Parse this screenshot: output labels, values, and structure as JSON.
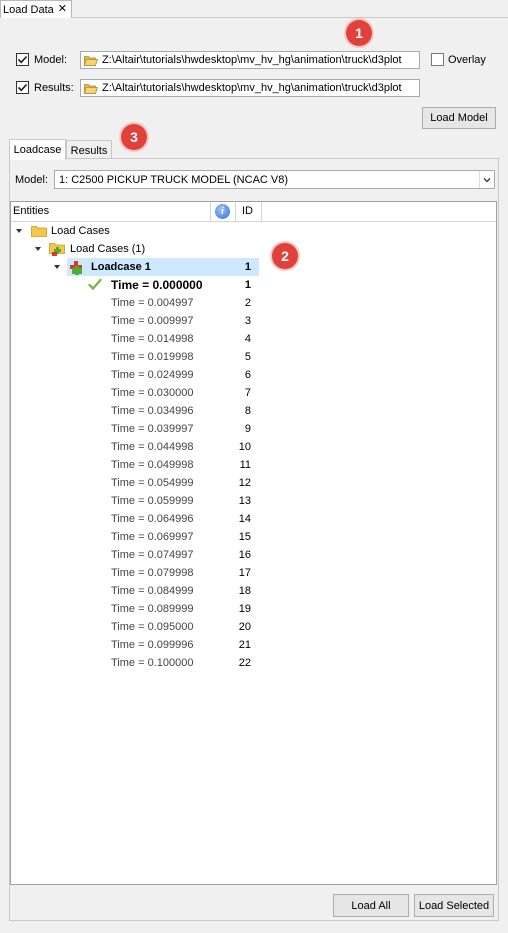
{
  "tab": {
    "title": "Load Data",
    "close": "✕"
  },
  "model_row": {
    "label": "Model:",
    "checked": true,
    "path": "Z:\\Altair\\tutorials\\hwdesktop\\mv_hv_hg\\animation\\truck\\d3plot"
  },
  "overlay": {
    "label": "Overlay",
    "checked": false
  },
  "results_row": {
    "label": "Results:",
    "checked": true,
    "path": "Z:\\Altair\\tutorials\\hwdesktop\\mv_hv_hg\\animation\\truck\\d3plot"
  },
  "load_model_button": "Load Model",
  "badges": {
    "b1": "1",
    "b2": "2",
    "b3": "3"
  },
  "tabs": [
    {
      "label": "Loadcase",
      "active": true
    },
    {
      "label": "Results",
      "active": false
    }
  ],
  "model_select": {
    "label": "Model:",
    "value": "1: C2500 PICKUP TRUCK MODEL (NCAC V8)"
  },
  "tree": {
    "col_entities": "Entities",
    "col_id": "ID",
    "root": "Load Cases",
    "group": "Load Cases (1)",
    "loadcase": {
      "label": "Loadcase 1",
      "id": "1"
    },
    "times": [
      {
        "label": "Time = 0.000000",
        "id": "1"
      },
      {
        "label": "Time = 0.004997",
        "id": "2"
      },
      {
        "label": "Time = 0.009997",
        "id": "3"
      },
      {
        "label": "Time = 0.014998",
        "id": "4"
      },
      {
        "label": "Time = 0.019998",
        "id": "5"
      },
      {
        "label": "Time = 0.024999",
        "id": "6"
      },
      {
        "label": "Time = 0.030000",
        "id": "7"
      },
      {
        "label": "Time = 0.034996",
        "id": "8"
      },
      {
        "label": "Time = 0.039997",
        "id": "9"
      },
      {
        "label": "Time = 0.044998",
        "id": "10"
      },
      {
        "label": "Time = 0.049998",
        "id": "11"
      },
      {
        "label": "Time = 0.054999",
        "id": "12"
      },
      {
        "label": "Time = 0.059999",
        "id": "13"
      },
      {
        "label": "Time = 0.064996",
        "id": "14"
      },
      {
        "label": "Time = 0.069997",
        "id": "15"
      },
      {
        "label": "Time = 0.074997",
        "id": "16"
      },
      {
        "label": "Time = 0.079998",
        "id": "17"
      },
      {
        "label": "Time = 0.084999",
        "id": "18"
      },
      {
        "label": "Time = 0.089999",
        "id": "19"
      },
      {
        "label": "Time = 0.095000",
        "id": "20"
      },
      {
        "label": "Time = 0.099996",
        "id": "21"
      },
      {
        "label": "Time = 0.100000",
        "id": "22"
      }
    ]
  },
  "load_all_button": "Load All",
  "load_selected_button": "Load Selected",
  "colors": {
    "badge": "#e0423b",
    "selection": "#cde8ff",
    "check_green": "#7ab648"
  }
}
